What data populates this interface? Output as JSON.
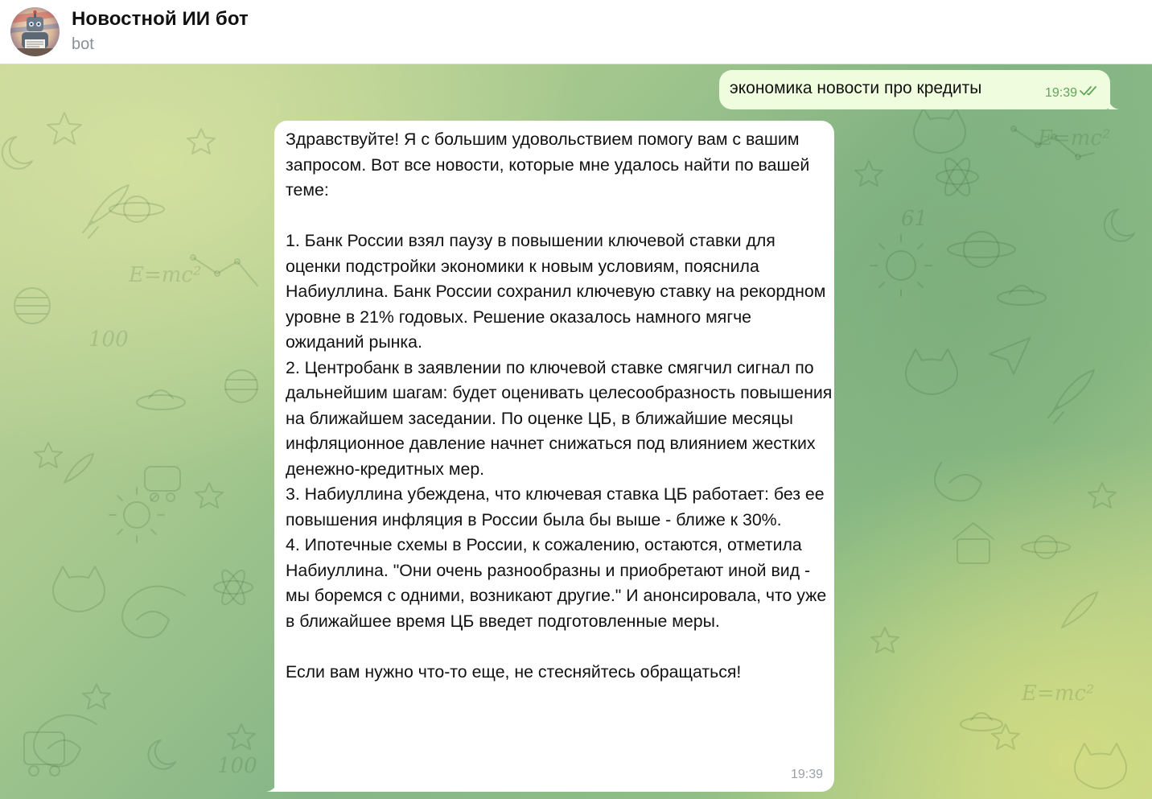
{
  "header": {
    "title": "Новостной ИИ бот",
    "subtitle": "bot",
    "avatar_icon": "robot-avatar-icon"
  },
  "messages": {
    "outgoing": {
      "text": "экономика новости про кредиты",
      "time": "19:39",
      "status_icon": "double-check-icon",
      "status": "read"
    },
    "incoming": {
      "text": "Здравствуйте! Я с большим удовольствием помогу вам с вашим запросом. Вот все новости, которые мне удалось найти по вашей теме:\n\n1. Банк России взял паузу в повышении ключевой ставки для оценки подстройки экономики к новым условиям, пояснила Набиуллина. Банк России сохранил ключевую ставку на рекордном уровне в 21% годовых. Решение оказалось намного мягче ожиданий рынка.\n2. Центробанк в заявлении по ключевой ставке смягчил сигнал по дальнейшим шагам: будет оценивать целесообразность повышения на ближайшем заседании. По оценке ЦБ, в ближайшие месяцы инфляционное давление начнет снижаться под влиянием жестких денежно-кредитных мер.\n3. Набиуллина убеждена, что ключевая ставка ЦБ работает: без ее повышения инфляция в России была бы выше - ближе к 30%.\n4. Ипотечные схемы в России, к сожалению, остаются, отметила Набиуллина. \"Они очень разнообразны и приобретают иной вид - мы боремся с одними, возникают другие.\" И анонсировала, что уже в ближайшее время ЦБ введет подготовленные меры.\n\nЕсли вам нужно что-то еще, не стесняйтесь обращаться!",
      "time": "19:39"
    }
  },
  "colors": {
    "outgoing_bubble": "#effdde",
    "incoming_bubble": "#ffffff",
    "read_check": "#5fa55a",
    "header_bg": "#ffffff"
  }
}
